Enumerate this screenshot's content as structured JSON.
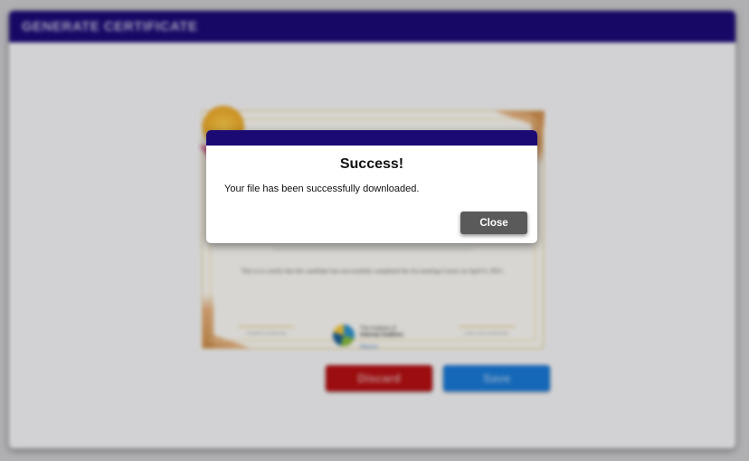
{
  "panel": {
    "title": "GENERATE CERTIFICATE"
  },
  "certificate": {
    "body_text": "This is to certify that the candidate has successfully completed the Accounting Course on April 6, 2021.",
    "signature_left": "TRAINER'S SIGNATURE",
    "signature_right": "DIRECTOR'S SIGNATURE",
    "logo_text_line1": "The Institute of",
    "logo_text_line2": "Internal Auditors",
    "logo_sub": "Malaysia"
  },
  "actions": {
    "discard_label": "Discard",
    "save_label": "Save"
  },
  "modal": {
    "title": "Success!",
    "message": "Your file has been successfully downloaded.",
    "close_label": "Close"
  },
  "colors": {
    "header": "#1c0a74",
    "discard": "#b10f12",
    "save": "#1877d2",
    "close": "#5a5a5a"
  }
}
